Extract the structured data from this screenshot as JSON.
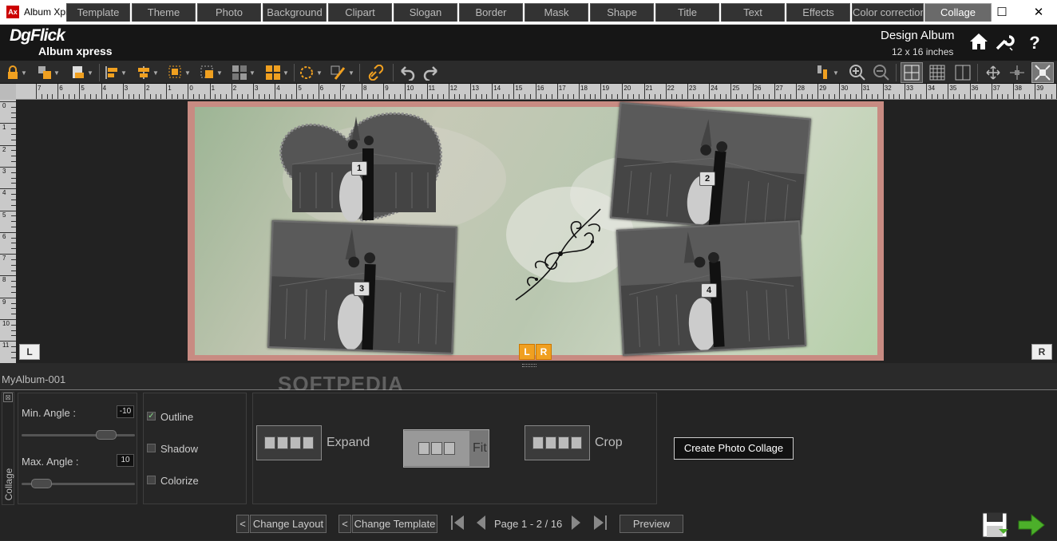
{
  "window": {
    "title": "Album Xpress",
    "icon_text": "Ax",
    "minimize": "—",
    "maximize": "☐",
    "close": "✕"
  },
  "header": {
    "logo_top": "DgFlick",
    "logo_bottom": "Album xpress",
    "title": "Design Album",
    "size": "12 x 16 inches",
    "icons": [
      "home-icon",
      "wrench-icon",
      "help-icon"
    ],
    "help_glyph": "?"
  },
  "ruler": {
    "h_labels": [
      "7",
      "6",
      "5",
      "4",
      "3",
      "2",
      "1",
      "0",
      "1",
      "2",
      "3",
      "4",
      "5",
      "6",
      "7",
      "8",
      "9",
      "10",
      "11",
      "12",
      "13",
      "14",
      "15",
      "16",
      "17",
      "18",
      "19",
      "20",
      "21",
      "22",
      "23",
      "24",
      "25",
      "26",
      "27",
      "28",
      "29",
      "30",
      "31",
      "32",
      "33",
      "34",
      "35",
      "36",
      "37",
      "38",
      "39"
    ],
    "v_labels": [
      "0",
      "1",
      "2",
      "3",
      "4",
      "5",
      "6",
      "7",
      "8",
      "9",
      "10",
      "11"
    ]
  },
  "canvas": {
    "photos": [
      "1",
      "2",
      "3",
      "4"
    ],
    "left_page": "L",
    "right_page": "R",
    "center_pages": [
      "L",
      "R"
    ]
  },
  "tabs": [
    "MyAlbum-001",
    "Template",
    "Theme",
    "Photo",
    "Background",
    "Clipart",
    "Slogan",
    "Border",
    "Mask",
    "Shape",
    "Title",
    "Text",
    "Effects",
    "Color correction",
    "Collage"
  ],
  "active_tab": "Collage",
  "panel": {
    "side_label": "Collage",
    "min_angle_label": "Min. Angle :",
    "min_angle_value": "-10",
    "min_angle_level": 0.8,
    "max_angle_label": "Max. Angle :",
    "max_angle_value": "10",
    "max_angle_level": 0.1,
    "options": [
      {
        "label": "Outline",
        "checked": true
      },
      {
        "label": "Shadow",
        "checked": false
      },
      {
        "label": "Colorize",
        "checked": false
      }
    ],
    "modes": [
      {
        "label": "Expand",
        "selected": false
      },
      {
        "label": "Fit",
        "selected": true
      },
      {
        "label": "Crop",
        "selected": false
      }
    ],
    "create_button": "Create Photo Collage"
  },
  "bottom": {
    "change_layout": "Change Layout",
    "change_template": "Change Template",
    "back_glyph": "<",
    "page_text": "Page 1 - 2 / 16",
    "preview": "Preview"
  },
  "watermark": "SOFTPEDIA",
  "colors": {
    "accent": "#f0a020",
    "next_arrow": "#4caf2a",
    "spread_border": "#c88b82"
  }
}
